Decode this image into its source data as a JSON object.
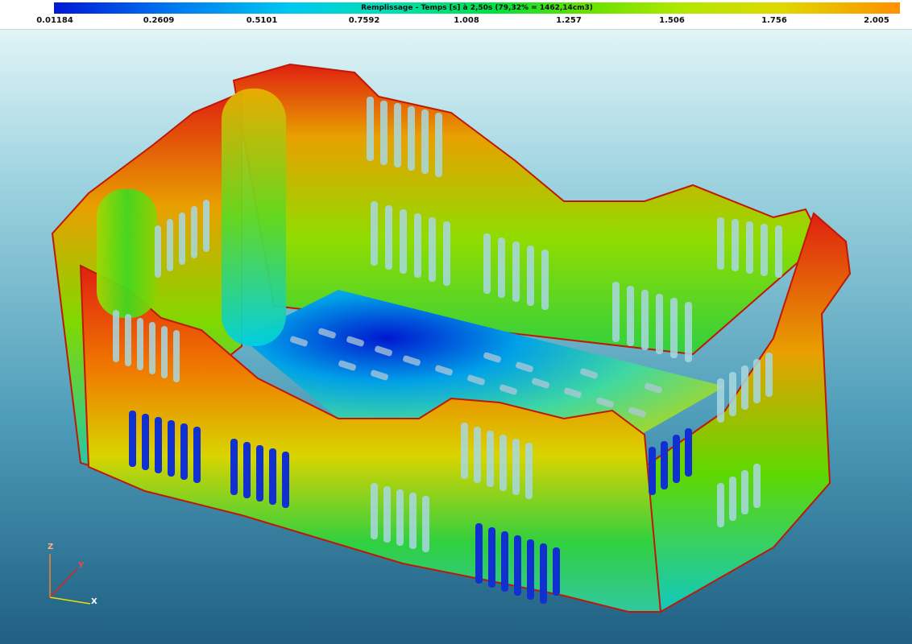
{
  "legend": {
    "title": "Remplissage - Temps [s] à 2,50s (79,32% = 1462,14cm3)",
    "ticks": [
      "0.01184",
      "0.2609",
      "0.5101",
      "0.7592",
      "1.008",
      "1.257",
      "1.506",
      "1.756",
      "2.005"
    ]
  },
  "axes": {
    "z": "Z",
    "y": "Y",
    "x": "X"
  },
  "colors": {
    "red": "#e02010",
    "orange": "#f08a00",
    "yellow": "#d8d800",
    "green": "#30d000",
    "cyan": "#00d0d0",
    "blue": "#0010d0"
  }
}
